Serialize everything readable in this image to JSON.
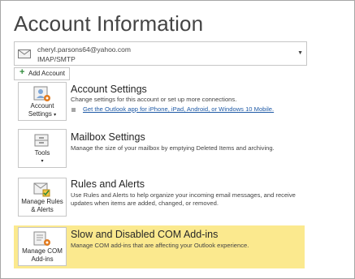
{
  "page": {
    "title": "Account Information"
  },
  "account_selector": {
    "email": "cheryl.parsons64@yahoo.com",
    "protocol": "IMAP/SMTP",
    "dropdown_icon": "chevron-down-icon"
  },
  "add_account": {
    "label": "Add Account",
    "icon": "plus-icon"
  },
  "sections": {
    "account_settings": {
      "button_line1": "Account",
      "button_line2": "Settings",
      "title": "Account Settings",
      "description": "Change settings for this account or set up more connections.",
      "link": "Get the Outlook app for iPhone, iPad, Android, or Windows 10 Mobile."
    },
    "mailbox_settings": {
      "button_label": "Tools",
      "title": "Mailbox Settings",
      "description": "Manage the size of your mailbox by emptying Deleted Items and archiving."
    },
    "rules_alerts": {
      "button_line1": "Manage Rules",
      "button_line2": "& Alerts",
      "title": "Rules and Alerts",
      "description": "Use Rules and Alerts to help organize your incoming email messages, and receive updates when items are added, changed, or removed."
    },
    "com_addins": {
      "button_line1": "Manage COM",
      "button_line2": "Add-ins",
      "title": "Slow and Disabled COM Add-ins",
      "description": "Manage COM add-ins that are affecting your Outlook experience.",
      "highlight_color": "#fbe98e"
    }
  },
  "colors": {
    "link": "#1f5aa6",
    "accent_green": "#2e8b3a",
    "icon_orange": "#e07a1f"
  }
}
